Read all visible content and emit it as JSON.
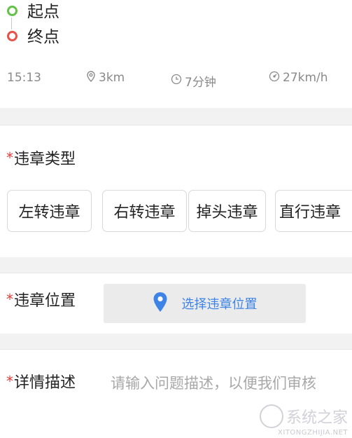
{
  "route": {
    "start_label": "起点",
    "end_label": "终点"
  },
  "stats": {
    "time": "15:13",
    "distance": "3km",
    "duration": "7分钟",
    "speed": "27km/h"
  },
  "violation_type": {
    "required_mark": "*",
    "label": "违章类型",
    "options": [
      "左转违章",
      "右转违章",
      "掉头违章",
      "直行违章"
    ]
  },
  "violation_location": {
    "required_mark": "*",
    "label": "违章位置",
    "button_label": "选择违章位置"
  },
  "description": {
    "required_mark": "*",
    "label": "详情描述",
    "placeholder": "请输入问题描述，以便我们审核"
  },
  "watermark": {
    "text": "系统之家",
    "url": "XITONGZHIJIA.NET"
  },
  "colors": {
    "start_dot": "#66c14a",
    "end_dot": "#e8514a",
    "required": "#e53935",
    "accent": "#3d84e6"
  }
}
